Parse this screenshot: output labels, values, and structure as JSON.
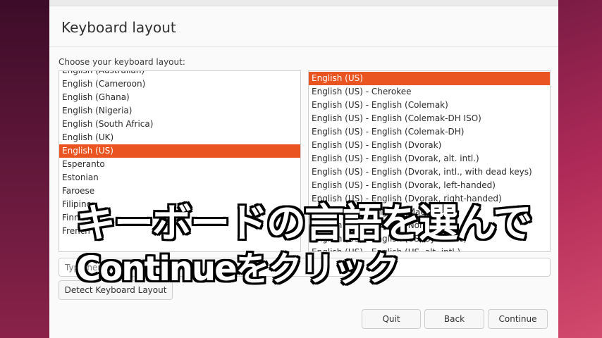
{
  "window": {
    "title": "Keyboard layout",
    "prompt": "Choose your keyboard layout:"
  },
  "layouts": [
    "English (Australian)",
    "English (Cameroon)",
    "English (Ghana)",
    "English (Nigeria)",
    "English (South Africa)",
    "English (UK)",
    "English (US)",
    "Esperanto",
    "Estonian",
    "Faroese",
    "Filipino",
    "Finnish",
    "French"
  ],
  "selected_layout": "English (US)",
  "variants": [
    "English (US)",
    "English (US) - Cherokee",
    "English (US) - English (Colemak)",
    "English (US) - English (Colemak-DH ISO)",
    "English (US) - English (Colemak-DH)",
    "English (US) - English (Dvorak)",
    "English (US) - English (Dvorak, alt. intl.)",
    "English (US) - English (Dvorak, intl., with dead keys)",
    "English (US) - English (Dvorak, left-handed)",
    "English (US) - English (Dvorak, right-handed)",
    "English (US) - English (Macintosh)",
    "English (US) - English (Norman)",
    "English (US) - English (US, Symbolic)",
    "English (US) - English (US, alt. intl.)"
  ],
  "selected_variant": "English (US)",
  "test_input": {
    "placeholder": "Type here to test your keyboard"
  },
  "buttons": {
    "detect": "Detect Keyboard Layout",
    "quit": "Quit",
    "back": "Back",
    "continue": "Continue"
  },
  "caption": {
    "line1": "キーボードの言語を選んで",
    "line2": "Continueをクリック"
  }
}
